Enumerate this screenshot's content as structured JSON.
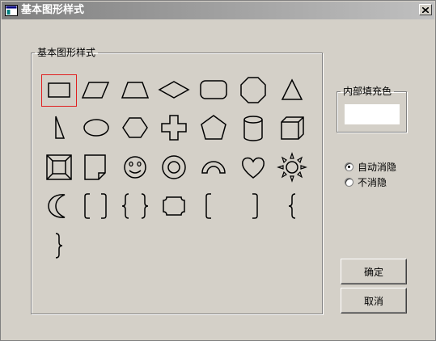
{
  "window": {
    "title": "基本图形样式"
  },
  "shapes_group": {
    "legend": "基本图形样式",
    "shapes": [
      {
        "name": "rectangle",
        "selected": true
      },
      {
        "name": "parallelogram"
      },
      {
        "name": "trapezoid"
      },
      {
        "name": "diamond"
      },
      {
        "name": "rounded-rectangle"
      },
      {
        "name": "octagon"
      },
      {
        "name": "isosceles-triangle"
      },
      {
        "name": "right-triangle"
      },
      {
        "name": "ellipse"
      },
      {
        "name": "hexagon"
      },
      {
        "name": "cross"
      },
      {
        "name": "pentagon"
      },
      {
        "name": "can"
      },
      {
        "name": "cube"
      },
      {
        "name": "bevel"
      },
      {
        "name": "folded-corner"
      },
      {
        "name": "smiley-face"
      },
      {
        "name": "donut"
      },
      {
        "name": "block-arc"
      },
      {
        "name": "heart"
      },
      {
        "name": "sun"
      },
      {
        "name": "moon"
      },
      {
        "name": "double-bracket"
      },
      {
        "name": "double-brace"
      },
      {
        "name": "plaque"
      },
      {
        "name": "left-bracket"
      },
      {
        "name": "right-bracket"
      },
      {
        "name": "left-brace"
      },
      {
        "name": "right-brace"
      }
    ]
  },
  "fill_group": {
    "legend": "内部填充色",
    "color": "#ffffff"
  },
  "options": [
    {
      "label": "自动消隐",
      "checked": true
    },
    {
      "label": "不消隐",
      "checked": false
    }
  ],
  "buttons": {
    "ok": "确定",
    "cancel": "取消"
  },
  "colors": {
    "selection_border": "#e02020",
    "face": "#d4d0c8"
  }
}
